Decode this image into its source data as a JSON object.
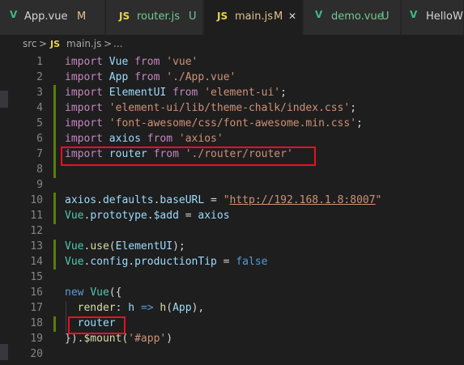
{
  "tabs": [
    {
      "icon": "vue-icon",
      "label": "App.vue",
      "status": "M",
      "active": false
    },
    {
      "icon": "js-icon",
      "label": "router.js",
      "status": "U",
      "active": false
    },
    {
      "icon": "js-icon",
      "label": "main.js",
      "status": "M",
      "active": true,
      "close": "✕"
    },
    {
      "icon": "vue-icon",
      "label": "demo.vue",
      "status": "U",
      "active": false
    },
    {
      "icon": "vue-icon",
      "label": "HelloW",
      "status": "",
      "active": false
    }
  ],
  "breadcrumb": {
    "folder": "src",
    "sep": ">",
    "file_icon": "JS",
    "file": "main.js",
    "more": "..."
  },
  "lines": [
    {
      "n": "1",
      "tokens": [
        [
          "kw",
          "import"
        ],
        [
          "plain",
          " "
        ],
        [
          "id",
          "Vue"
        ],
        [
          "plain",
          " "
        ],
        [
          "kw",
          "from"
        ],
        [
          "plain",
          " "
        ],
        [
          "str",
          "'vue'"
        ]
      ]
    },
    {
      "n": "2",
      "tokens": [
        [
          "kw",
          "import"
        ],
        [
          "plain",
          " "
        ],
        [
          "id",
          "App"
        ],
        [
          "plain",
          " "
        ],
        [
          "kw",
          "from"
        ],
        [
          "plain",
          " "
        ],
        [
          "str",
          "'./App.vue'"
        ]
      ]
    },
    {
      "n": "3",
      "tokens": [
        [
          "kw",
          "import"
        ],
        [
          "plain",
          " "
        ],
        [
          "id",
          "ElementUI"
        ],
        [
          "plain",
          " "
        ],
        [
          "kw",
          "from"
        ],
        [
          "plain",
          " "
        ],
        [
          "str",
          "'element-ui'"
        ],
        [
          "plain",
          ";"
        ]
      ]
    },
    {
      "n": "4",
      "tokens": [
        [
          "kw",
          "import"
        ],
        [
          "plain",
          " "
        ],
        [
          "str",
          "'element-ui/lib/theme-chalk/index.css'"
        ],
        [
          "plain",
          ";"
        ]
      ]
    },
    {
      "n": "5",
      "tokens": [
        [
          "kw",
          "import"
        ],
        [
          "plain",
          " "
        ],
        [
          "str",
          "'font-awesome/css/font-awesome.min.css'"
        ],
        [
          "plain",
          ";"
        ]
      ]
    },
    {
      "n": "6",
      "tokens": [
        [
          "kw",
          "import"
        ],
        [
          "plain",
          " "
        ],
        [
          "id",
          "axios"
        ],
        [
          "plain",
          " "
        ],
        [
          "kw",
          "from"
        ],
        [
          "plain",
          " "
        ],
        [
          "str",
          "'axios'"
        ]
      ]
    },
    {
      "n": "7",
      "tokens": [
        [
          "kw",
          "import"
        ],
        [
          "plain",
          " "
        ],
        [
          "id",
          "router"
        ],
        [
          "plain",
          " "
        ],
        [
          "kw",
          "from"
        ],
        [
          "plain",
          " "
        ],
        [
          "str",
          "'./router/router'"
        ]
      ]
    },
    {
      "n": "8",
      "tokens": []
    },
    {
      "n": "9",
      "tokens": []
    },
    {
      "n": "10",
      "tokens": [
        [
          "id",
          "axios"
        ],
        [
          "plain",
          "."
        ],
        [
          "id",
          "defaults"
        ],
        [
          "plain",
          "."
        ],
        [
          "id",
          "baseURL"
        ],
        [
          "plain",
          " = "
        ],
        [
          "str",
          "\""
        ],
        [
          "url",
          "http://192.168.1.8:8007"
        ],
        [
          "str",
          "\""
        ]
      ]
    },
    {
      "n": "11",
      "tokens": [
        [
          "cls",
          "Vue"
        ],
        [
          "plain",
          "."
        ],
        [
          "id",
          "prototype"
        ],
        [
          "plain",
          "."
        ],
        [
          "id",
          "$add"
        ],
        [
          "plain",
          " = "
        ],
        [
          "id",
          "axios"
        ]
      ]
    },
    {
      "n": "12",
      "tokens": []
    },
    {
      "n": "13",
      "tokens": [
        [
          "cls",
          "Vue"
        ],
        [
          "plain",
          "."
        ],
        [
          "fn",
          "use"
        ],
        [
          "plain",
          "("
        ],
        [
          "id",
          "ElementUI"
        ],
        [
          "plain",
          ");"
        ]
      ]
    },
    {
      "n": "14",
      "tokens": [
        [
          "cls",
          "Vue"
        ],
        [
          "plain",
          "."
        ],
        [
          "id",
          "config"
        ],
        [
          "plain",
          "."
        ],
        [
          "id",
          "productionTip"
        ],
        [
          "plain",
          " = "
        ],
        [
          "bool",
          "false"
        ]
      ]
    },
    {
      "n": "15",
      "tokens": []
    },
    {
      "n": "16",
      "tokens": [
        [
          "kwb",
          "new"
        ],
        [
          "plain",
          " "
        ],
        [
          "cls",
          "Vue"
        ],
        [
          "plain",
          "({"
        ]
      ]
    },
    {
      "n": "17",
      "tokens": [
        [
          "plain",
          "  "
        ],
        [
          "fn",
          "render"
        ],
        [
          "plain",
          ": "
        ],
        [
          "id",
          "h"
        ],
        [
          "plain",
          " "
        ],
        [
          "kwb",
          "=>"
        ],
        [
          "plain",
          " "
        ],
        [
          "fn",
          "h"
        ],
        [
          "plain",
          "("
        ],
        [
          "id",
          "App"
        ],
        [
          "plain",
          "),"
        ]
      ]
    },
    {
      "n": "18",
      "tokens": [
        [
          "plain",
          "  "
        ],
        [
          "id",
          "router"
        ]
      ]
    },
    {
      "n": "19",
      "tokens": [
        [
          "plain",
          "})."
        ],
        [
          "fn",
          "$mount"
        ],
        [
          "plain",
          "("
        ],
        [
          "str",
          "'#app'"
        ],
        [
          "plain",
          ")"
        ]
      ]
    },
    {
      "n": "20",
      "tokens": []
    }
  ]
}
